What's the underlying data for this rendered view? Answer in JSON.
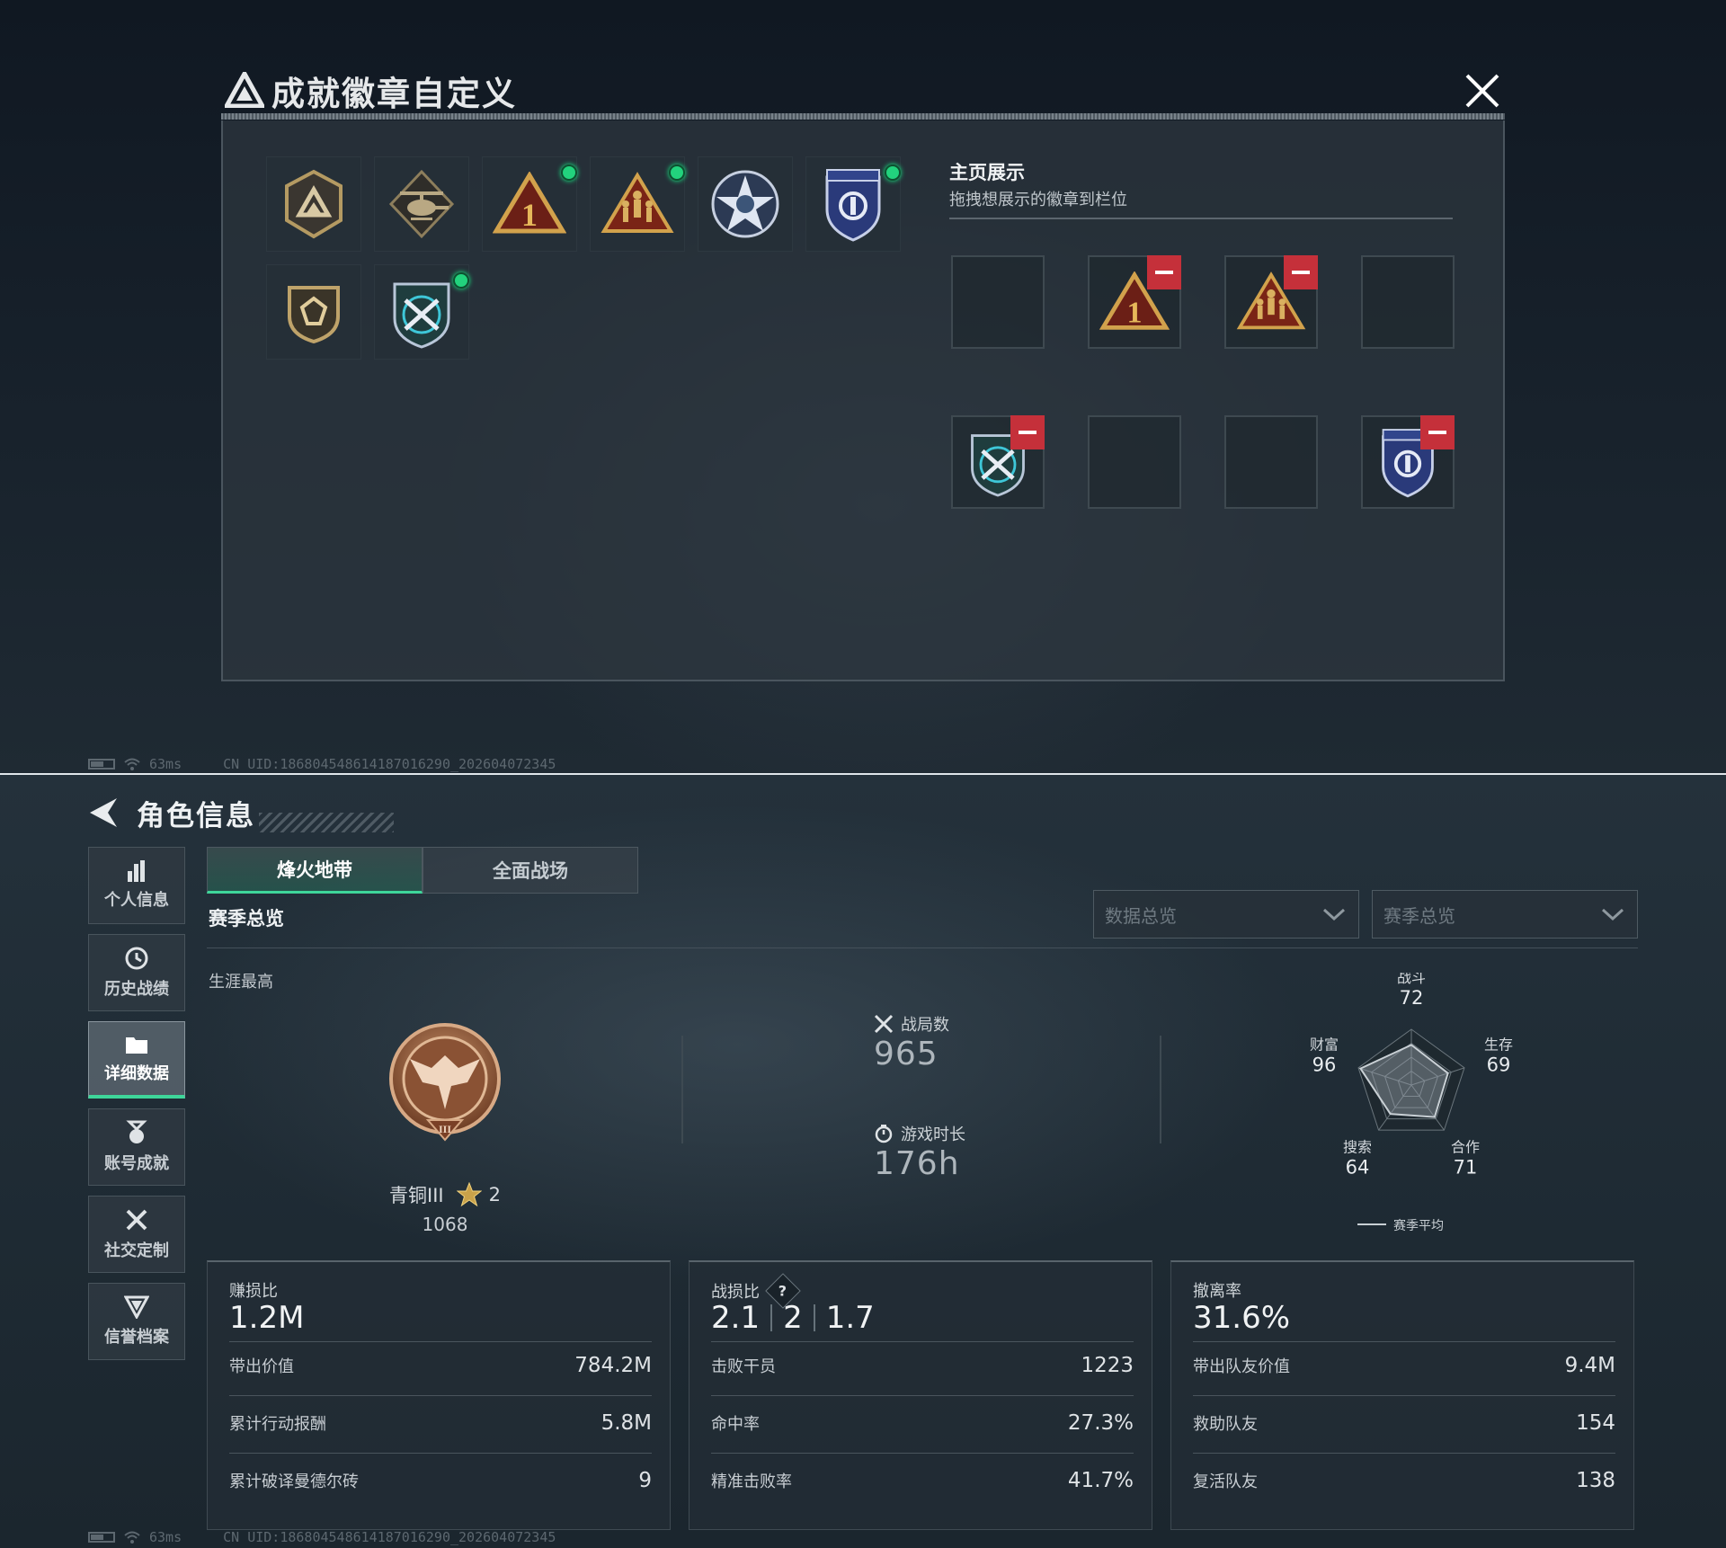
{
  "top_statusbar": {
    "ping": "63ms",
    "uid": "CN UID:18680454861418701629​0_202604072345"
  },
  "bottom_statusbar": {
    "ping": "63ms",
    "uid": "CN UID:18680454861418701629​0_202604072345"
  },
  "dialog": {
    "title": "成就徽章自定义",
    "badges": [
      {
        "icon": "delta-shield-badge-icon",
        "new": false
      },
      {
        "icon": "helicopter-badge-icon",
        "new": false
      },
      {
        "icon": "number-one-triangle-badge-icon",
        "new": true
      },
      {
        "icon": "soldiers-triangle-badge-icon",
        "new": true
      },
      {
        "icon": "star-emblem-badge-icon",
        "new": false
      },
      {
        "icon": "blue-shield-badge-icon",
        "new": true
      },
      {
        "icon": "gem-shield-badge-icon",
        "new": false
      },
      {
        "icon": "crossed-weapons-shield-badge-icon",
        "new": true
      }
    ],
    "homepage": {
      "title": "主页展示",
      "subtitle": "拖拽想展示的徽章到栏位",
      "slots": [
        {
          "badge": null
        },
        {
          "badge": "number-one-triangle-badge-icon"
        },
        {
          "badge": "soldiers-triangle-badge-icon"
        },
        {
          "badge": null
        },
        {
          "badge": "crossed-weapons-shield-badge-icon"
        },
        {
          "badge": null
        },
        {
          "badge": null
        },
        {
          "badge": "blue-shield-badge-icon"
        }
      ]
    }
  },
  "page": {
    "title": "角色信息",
    "side_nav": [
      {
        "label": "个人信息",
        "icon": "bar-chart-icon",
        "active": false
      },
      {
        "label": "历史战绩",
        "icon": "history-clock-icon",
        "active": false
      },
      {
        "label": "详细数据",
        "icon": "folder-icon",
        "active": true
      },
      {
        "label": "账号成就",
        "icon": "medal-icon",
        "active": false
      },
      {
        "label": "社交定制",
        "icon": "tools-icon",
        "active": false
      },
      {
        "label": "信誉档案",
        "icon": "shield-v-icon",
        "active": false
      }
    ],
    "tabs": [
      {
        "label": "烽火地带",
        "active": true
      },
      {
        "label": "全面战场",
        "active": false
      }
    ],
    "section_title": "赛季总览",
    "dropdowns": {
      "data": "数据总览",
      "season": "赛季总览"
    },
    "career_best_label": "生涯最高",
    "rank": {
      "name": "青铜III",
      "stars": "2",
      "score": "1068"
    },
    "matches": {
      "label": "战局数",
      "value": "965"
    },
    "playtime": {
      "label": "游戏时长",
      "value": "176h"
    },
    "radar": {
      "legend": "赛季平均",
      "axes": [
        {
          "name": "战斗",
          "value": 72
        },
        {
          "name": "生存",
          "value": 69
        },
        {
          "name": "合作",
          "value": 71
        },
        {
          "name": "搜索",
          "value": 64
        },
        {
          "name": "财富",
          "value": 96
        }
      ]
    },
    "cards": [
      {
        "label": "赚损比",
        "values": [
          "1.2M"
        ],
        "rows": [
          {
            "label": "带出价值",
            "value": "784.2M"
          },
          {
            "label": "累计行动报酬",
            "value": "5.8M"
          },
          {
            "label": "累计破译曼德尔砖",
            "value": "9"
          }
        ]
      },
      {
        "label": "战损比",
        "help": "?",
        "values": [
          "2.1",
          "2",
          "1.7"
        ],
        "rows": [
          {
            "label": "击败干员",
            "value": "1223"
          },
          {
            "label": "命中率",
            "value": "27.3%"
          },
          {
            "label": "精准击败率",
            "value": "41.7%"
          }
        ]
      },
      {
        "label": "撤离率",
        "values": [
          "31.6%"
        ],
        "rows": [
          {
            "label": "带出队友价值",
            "value": "9.4M"
          },
          {
            "label": "救助队友",
            "value": "154"
          },
          {
            "label": "复活队友",
            "value": "138"
          }
        ]
      }
    ]
  },
  "colors": {
    "accent": "#3ed69a",
    "new_dot": "#22d37d",
    "remove": "#c5303a",
    "gold": "#c9a24a"
  }
}
